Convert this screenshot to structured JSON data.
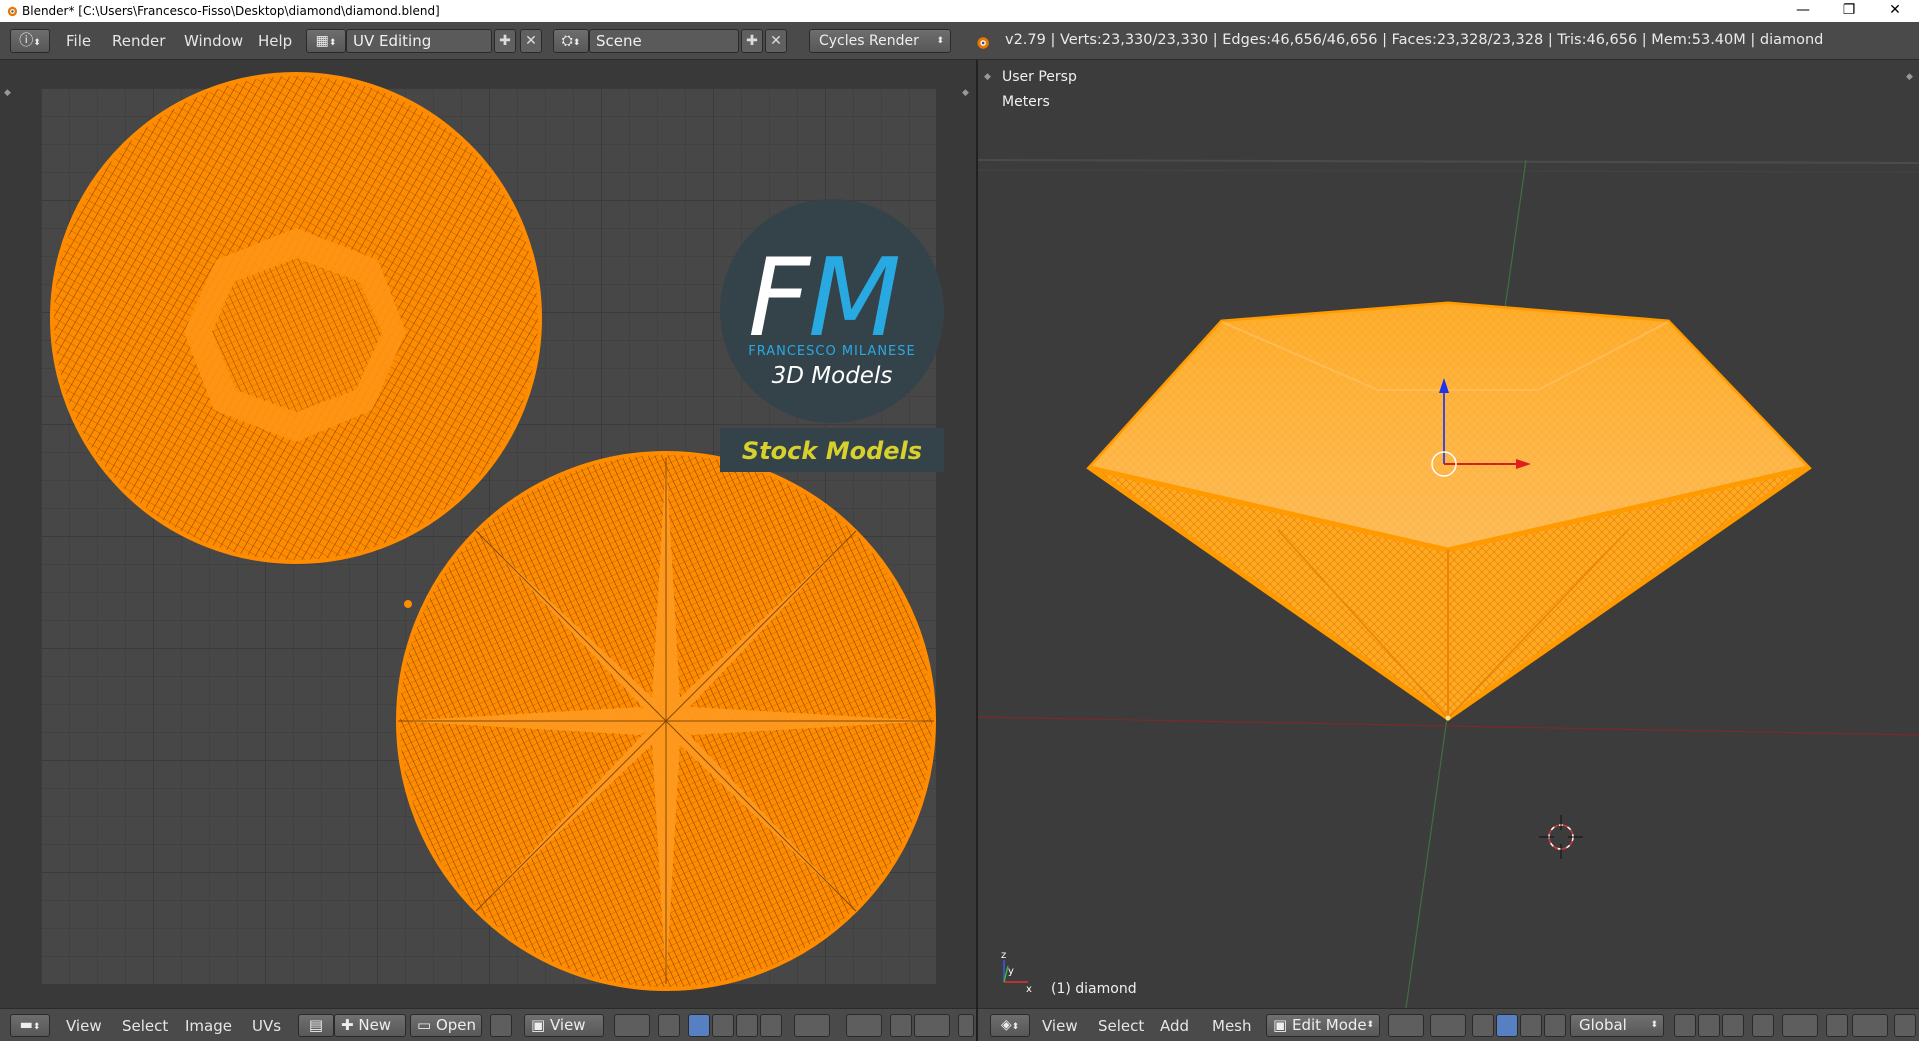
{
  "window": {
    "title": "Blender* [C:\\Users\\Francesco-Fisso\\Desktop\\diamond\\diamond.blend]",
    "minimize": "—",
    "restore": "❐",
    "close": "✕"
  },
  "info_header": {
    "editor_icon": "info-icon",
    "menus": [
      "File",
      "Render",
      "Window",
      "Help"
    ],
    "screen_layout": "UV Editing",
    "scene": "Scene",
    "render_engine": "Cycles Render",
    "stats": "v2.79 | Verts:23,330/23,330 | Edges:46,656/46,656 | Faces:23,328/23,328 | Tris:46,656 | Mem:53.40M | diamond"
  },
  "uv_editor": {
    "watermark": {
      "letters_f": "F",
      "letters_m": "M",
      "brand": "FRANCESCO MILANESE",
      "tagline": "3D Models",
      "banner": "Stock Models"
    },
    "footer": {
      "menus": [
        "View",
        "Select",
        "Image",
        "UVs"
      ],
      "new_label": "New",
      "open_label": "Open",
      "view_label": "View"
    }
  },
  "viewport": {
    "perspective": "User Persp",
    "units": "Meters",
    "object_label": "(1) diamond",
    "footer": {
      "menus": [
        "View",
        "Select",
        "Add",
        "Mesh"
      ],
      "mode": "Edit Mode",
      "orientation": "Global"
    }
  },
  "colors": {
    "mesh_orange": "#ff8c00",
    "selected_orange": "#ffa31a",
    "watermark_blue": "#29a9e1",
    "banner_yellow": "#d8d02c",
    "panel_bg": "#393939",
    "header_bg": "#4a4a4a"
  }
}
